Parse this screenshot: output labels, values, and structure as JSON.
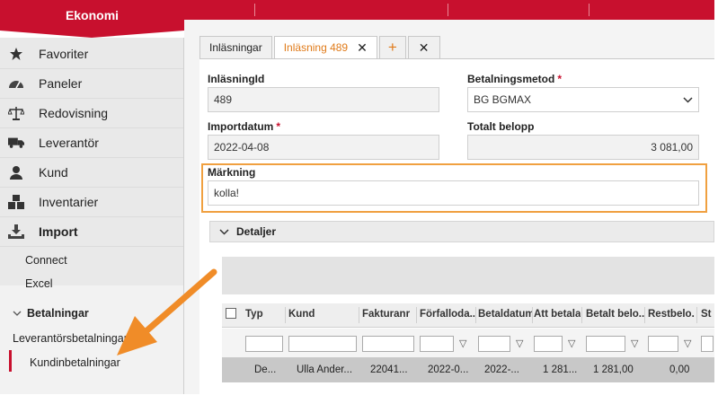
{
  "app": {
    "title": "Ekonomi"
  },
  "sidebar": {
    "items": [
      {
        "label": "Favoriter",
        "icon": "star-icon"
      },
      {
        "label": "Paneler",
        "icon": "gauge-icon"
      },
      {
        "label": "Redovisning",
        "icon": "scale-icon"
      },
      {
        "label": "Leverantör",
        "icon": "truck-icon"
      },
      {
        "label": "Kund",
        "icon": "person-icon"
      },
      {
        "label": "Inventarier",
        "icon": "boxes-icon"
      },
      {
        "label": "Import",
        "icon": "import-icon"
      }
    ],
    "import_sub": {
      "connect": "Connect",
      "excel": "Excel"
    },
    "betalningar": {
      "label": "Betalningar",
      "items": [
        "Leverantörsbetalningar",
        "Kundinbetalningar"
      ]
    }
  },
  "tabs": [
    {
      "label": "Inläsningar",
      "active": false
    },
    {
      "label": "Inläsning 489",
      "active": true
    }
  ],
  "form": {
    "inlasning_id": {
      "label": "InläsningId",
      "value": "489"
    },
    "betalningsmetod": {
      "label": "Betalningsmetod",
      "required": "*",
      "value": "BG BGMAX"
    },
    "importdatum": {
      "label": "Importdatum",
      "required": "*",
      "value": "2022-04-08"
    },
    "totalt_belopp": {
      "label": "Totalt belopp",
      "value": "3 081,00"
    },
    "markning": {
      "label": "Märkning",
      "value": "kolla!"
    }
  },
  "details": {
    "title": "Detaljer",
    "columns": [
      "Typ",
      "Kund",
      "Fakturanr",
      "Förfalloda...",
      "Betaldatum",
      "Att betala",
      "Betalt belo...",
      "Restbelo...",
      "St"
    ],
    "row": [
      "De...",
      "Ulla Ander...",
      "22041...",
      "2022-0...",
      "2022-...",
      "1 281...",
      "1 281,00",
      "0,00"
    ]
  },
  "colors": {
    "brand_red": "#c8102e",
    "accent_orange": "#e07b1a",
    "highlight": "#f0a040"
  }
}
